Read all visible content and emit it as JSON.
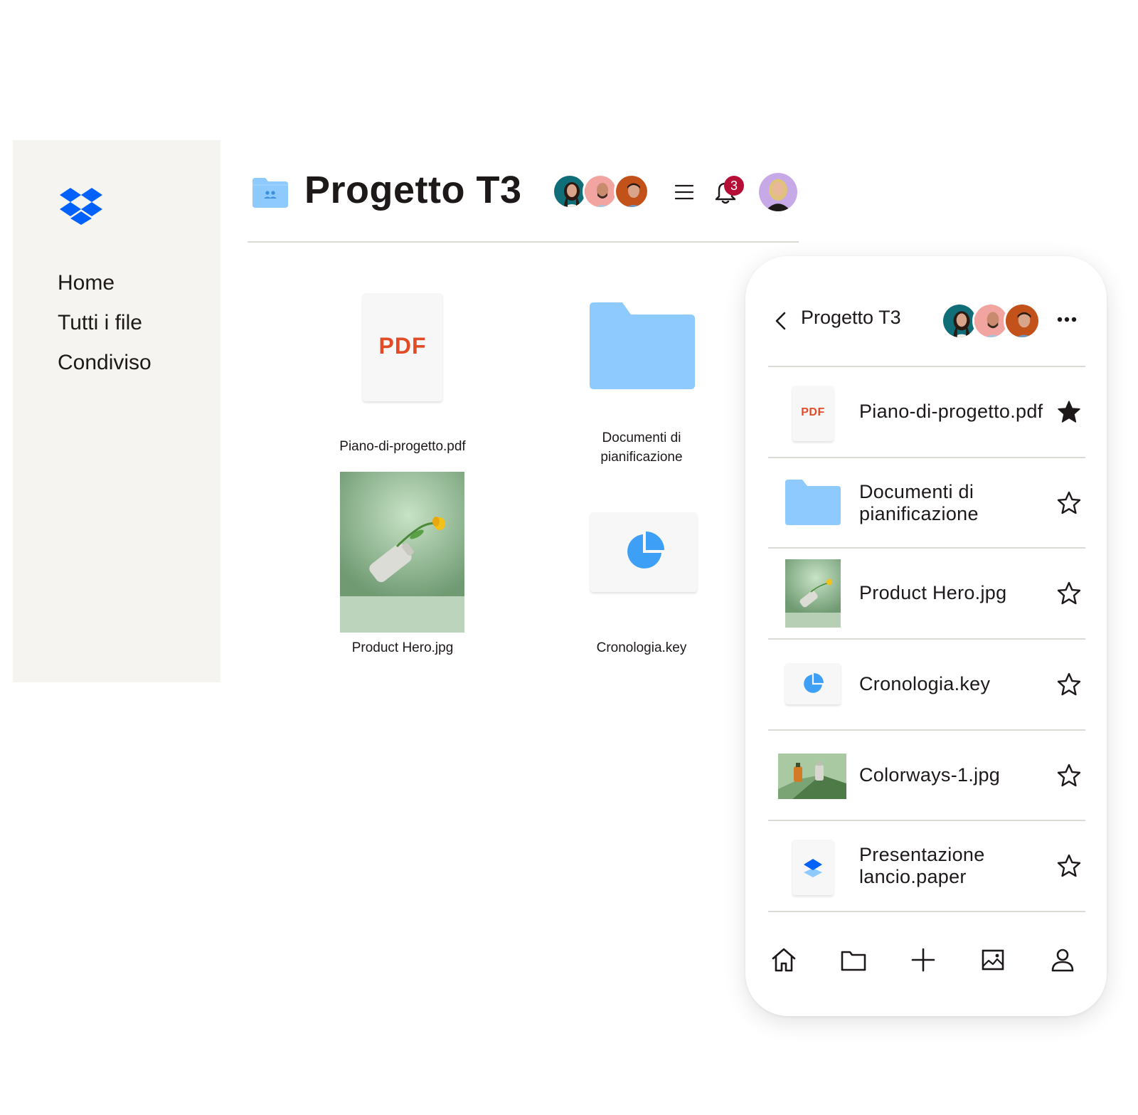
{
  "sidebar": {
    "items": [
      {
        "label": "Home"
      },
      {
        "label": "Tutti i file"
      },
      {
        "label": "Condiviso"
      }
    ]
  },
  "header": {
    "title": "Progetto T3",
    "notifications_count": "3"
  },
  "grid": {
    "pdf_card_text": "PDF",
    "items": [
      {
        "label": "Piano-di-progetto.pdf"
      },
      {
        "label": "Documenti di\npianificazione"
      },
      {
        "label": "Product Hero.jpg"
      },
      {
        "label": "Cronologia.key"
      }
    ]
  },
  "phone": {
    "title": "Progetto T3",
    "pdf_thumb_text": "PDF",
    "files": [
      {
        "name": "Piano-di-progetto.pdf",
        "starred": true
      },
      {
        "name": "Documenti di\npianificazione",
        "starred": false
      },
      {
        "name": "Product Hero.jpg",
        "starred": false
      },
      {
        "name": "Cronologia.key",
        "starred": false
      },
      {
        "name": "Colorways-1.jpg",
        "starred": false
      },
      {
        "name": "Presentazione\nlancio.paper",
        "starred": false
      }
    ]
  },
  "colors": {
    "brand": "#0061fe",
    "folder": "#8fcaff",
    "pdf": "#e24b26",
    "badge": "#b50f37",
    "sidebar_bg": "#f5f4f0"
  }
}
